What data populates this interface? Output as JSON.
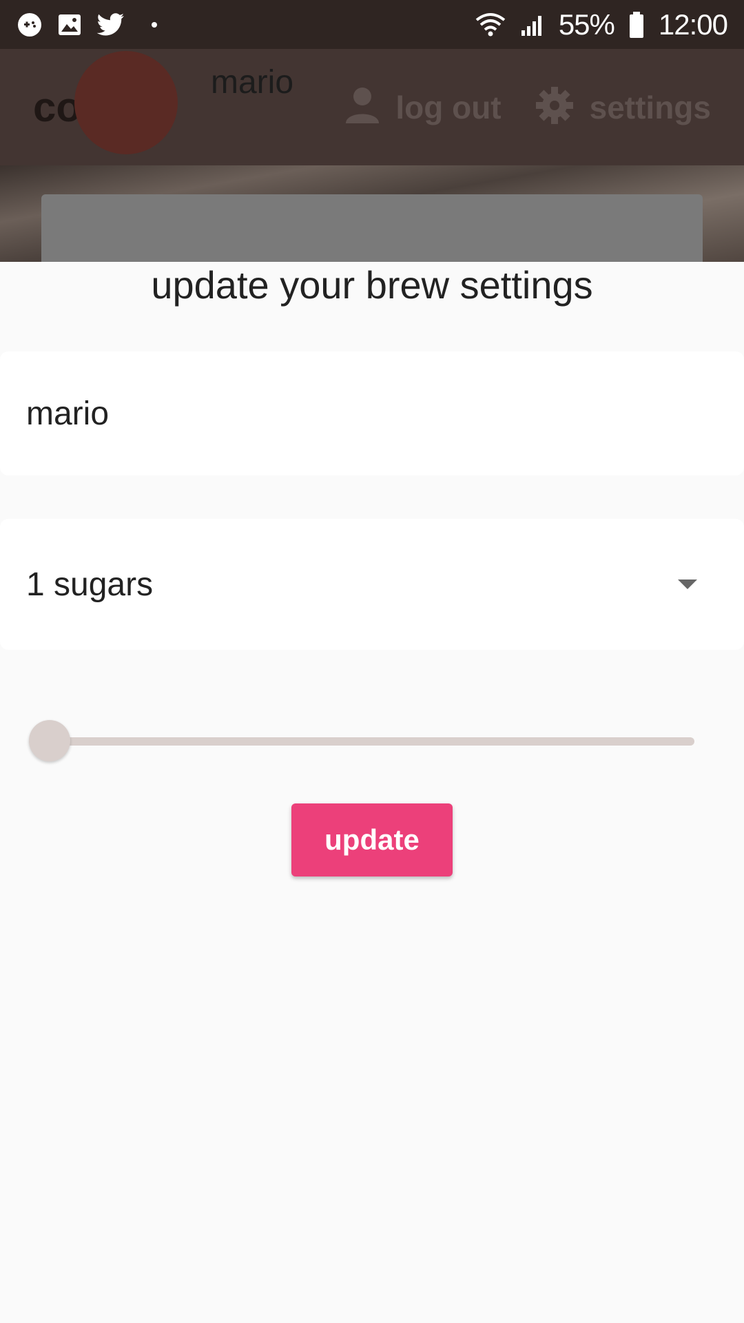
{
  "status_bar": {
    "left_icons": [
      "game-icon",
      "image-icon",
      "twitter-icon",
      "dot-icon"
    ],
    "battery_percent": "55%",
    "time": "12:00"
  },
  "app_bar": {
    "title": "coffee",
    "logout_label": "log out",
    "settings_label": "settings"
  },
  "background_card": {
    "name": "mario"
  },
  "sheet": {
    "title": "update your brew settings",
    "name_field": {
      "value": "mario"
    },
    "sugar_select": {
      "value": "1 sugars"
    },
    "strength_slider": {
      "level": 0
    },
    "update_label": "update"
  },
  "colors": {
    "accent": "#ec407a",
    "app_bar": "#433532",
    "status_bar": "#2f2522"
  }
}
